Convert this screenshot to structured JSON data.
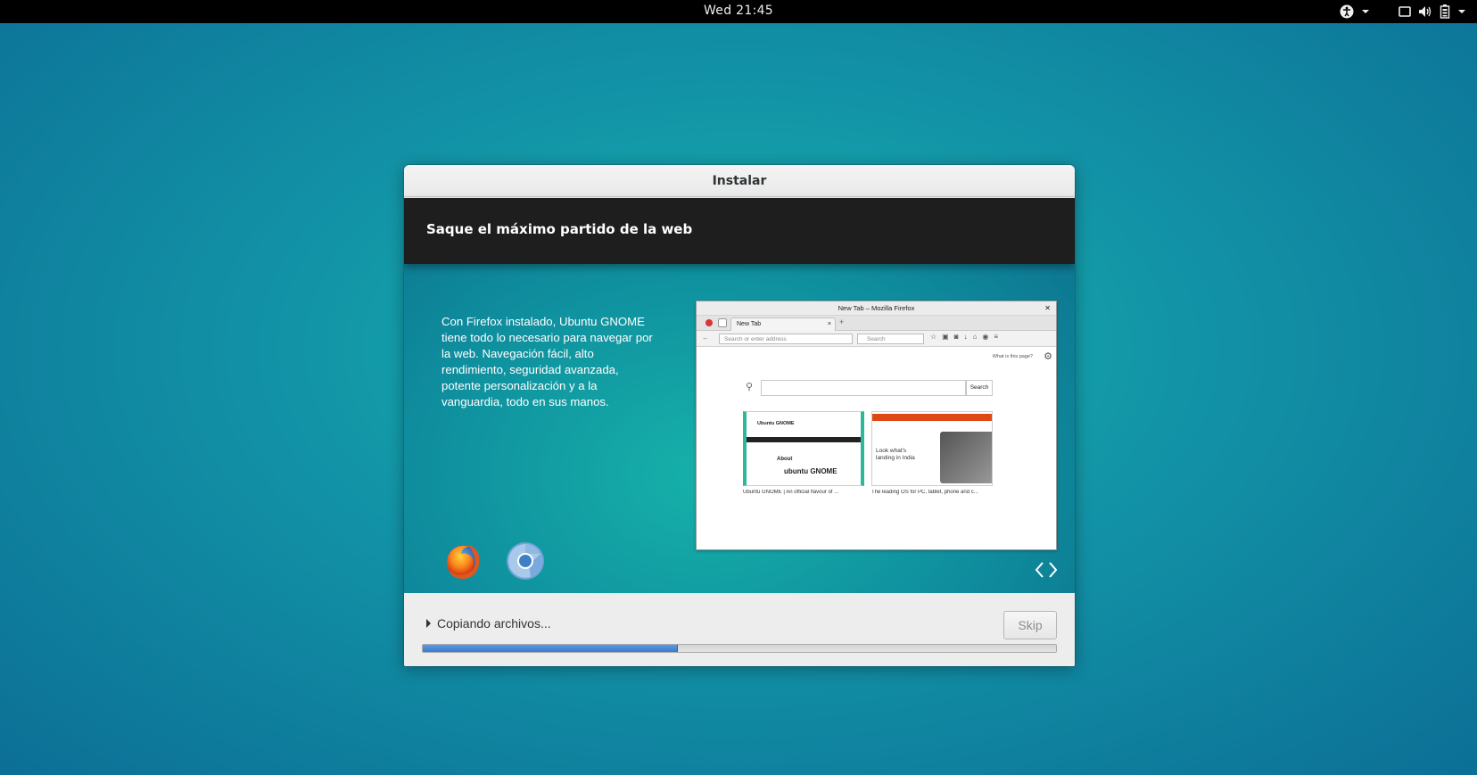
{
  "topbar": {
    "clock": "Wed 21:45",
    "icons": [
      "accessibility-icon",
      "window-icon",
      "volume-icon",
      "battery-icon"
    ]
  },
  "dialog": {
    "title": "Instalar",
    "slide": {
      "heading": "Saque el máximo partido de la web",
      "body": "Con Firefox instalado, Ubuntu GNOME tiene todo lo necesario para navegar por la web. Navegación fácil, alto rendimiento, seguridad avanzada, potente personalización y a la vanguardia, todo en sus manos.",
      "screenshot": {
        "window_title": "New Tab – Mozilla Firefox",
        "tab_label": "New Tab",
        "address_placeholder": "Search or enter address",
        "search_placeholder": "Search",
        "what_is_this": "What is this page?",
        "search_button": "Search",
        "tiles": [
          {
            "caption": "Ubuntu GNOME | An official flavour of ...",
            "heading": "Ubuntu GNOME",
            "about": "About",
            "logo": "ubuntu GNOME"
          },
          {
            "caption": "The leading OS for PC, tablet, phone and c...",
            "text": "Look what's landing in India"
          }
        ]
      },
      "app_icons": [
        "firefox-icon",
        "chromium-icon"
      ]
    },
    "footer": {
      "status": "Copiando archivos...",
      "skip_label": "Skip",
      "progress_fraction": 0.403
    }
  },
  "colors": {
    "accent": "#3b7bd0",
    "slide_header_bg": "#1e1e1e",
    "desktop_teal": "#17b3ad"
  }
}
